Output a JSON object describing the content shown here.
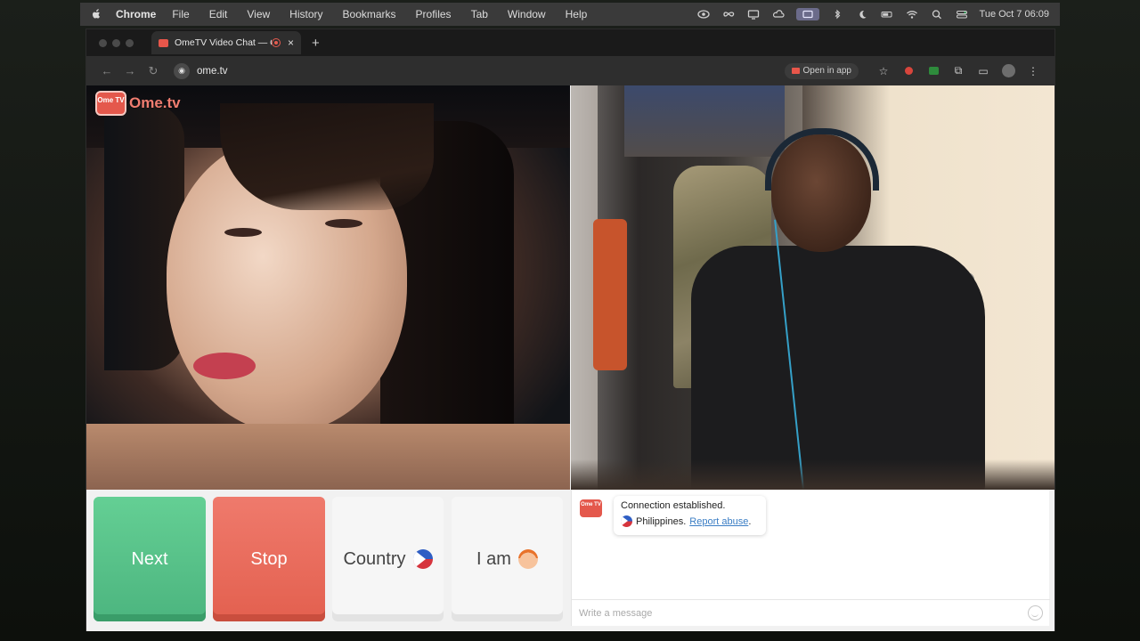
{
  "menubar": {
    "app_name": "Chrome",
    "items": [
      "File",
      "Edit",
      "View",
      "History",
      "Bookmarks",
      "Profiles",
      "Tab",
      "Window",
      "Help"
    ],
    "clock": "Tue Oct 7  06:09",
    "status_icons": [
      "eye-icon",
      "infinity-icon",
      "display-icon",
      "cloud-icon",
      "screen-mirroring-icon",
      "bluetooth-icon",
      "moon-icon",
      "battery-icon",
      "wifi-icon",
      "search-icon",
      "control-center-icon"
    ]
  },
  "browser": {
    "tab_title": "OmeTV Video Chat — Om",
    "tab_close": "×",
    "new_tab": "+",
    "url": "ome.tv",
    "open_in_app": "Open in app"
  },
  "page": {
    "logo_tv_text": "Ome TV",
    "logo_word": "Ome.tv",
    "buttons": {
      "next": "Next",
      "stop": "Stop",
      "country": "Country",
      "iam": "I am"
    },
    "chat": {
      "status": "Connection established.",
      "country": "Philippines.",
      "report": "Report abuse",
      "report_suffix": ".",
      "placeholder": "Write a message"
    }
  },
  "colors": {
    "next": "#5bc38a",
    "stop": "#e86b5b",
    "brand": "#e4584c",
    "link": "#3a7dc4"
  }
}
